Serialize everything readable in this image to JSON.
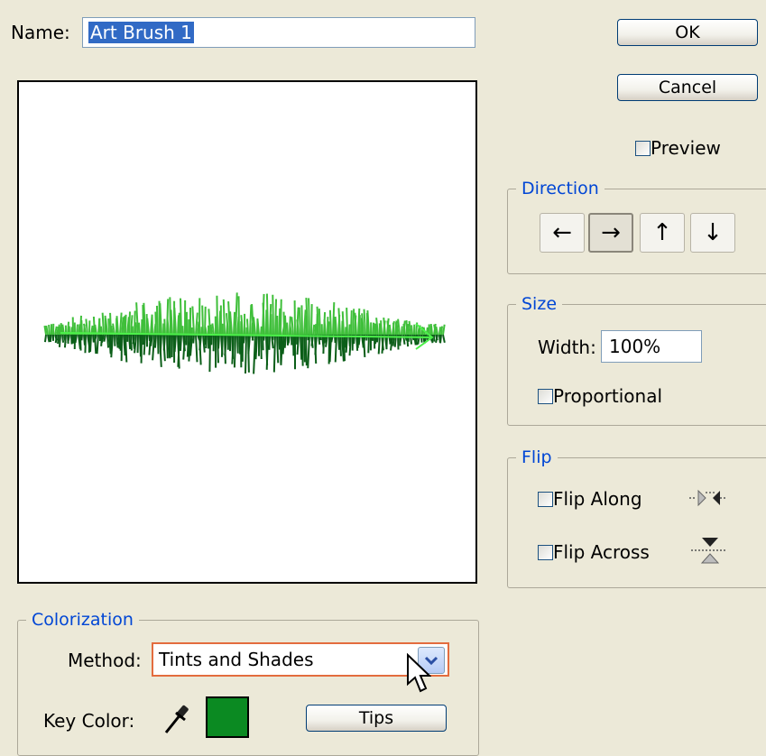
{
  "name": {
    "label": "Name:",
    "value": "Art Brush 1"
  },
  "buttons": {
    "ok": "OK",
    "cancel": "Cancel",
    "tips": "Tips"
  },
  "preview": {
    "label": "Preview",
    "checked": false
  },
  "direction": {
    "title": "Direction",
    "buttons": [
      {
        "glyph": "←",
        "icon": "arrow-left-icon",
        "active": false
      },
      {
        "glyph": "→",
        "icon": "arrow-right-icon",
        "active": true
      },
      {
        "glyph": "↑",
        "icon": "arrow-up-icon",
        "active": false
      },
      {
        "glyph": "↓",
        "icon": "arrow-down-icon",
        "active": false
      }
    ]
  },
  "size": {
    "title": "Size",
    "width_label": "Width:",
    "width_value": "100%",
    "proportional_label": "Proportional"
  },
  "flip": {
    "title": "Flip",
    "along_label": "Flip Along",
    "across_label": "Flip Across"
  },
  "colorization": {
    "title": "Colorization",
    "method_label": "Method:",
    "method_value": "Tints and Shades",
    "key_color_label": "Key Color:",
    "key_color": "#0b8a22"
  },
  "colors": {
    "legend": "#0046d5",
    "brush_dark": "#0b5e18",
    "brush_light": "#3fbf3a",
    "guide_line": "#4cf04a"
  }
}
